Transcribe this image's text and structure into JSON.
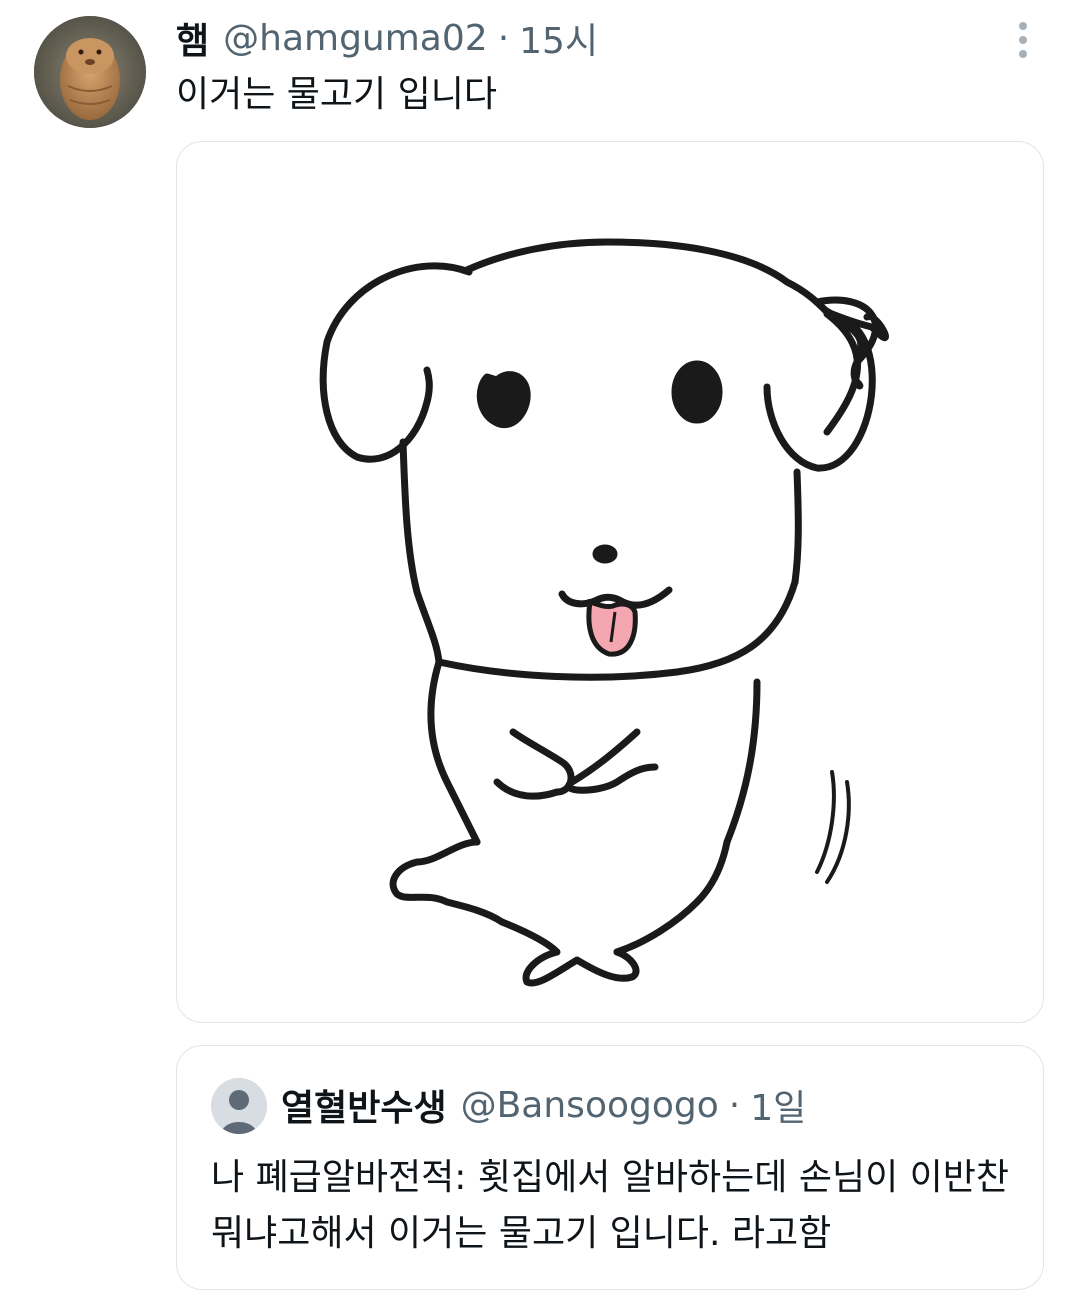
{
  "tweet": {
    "author": {
      "display_name": "햄",
      "handle": "@hamguma02",
      "avatar_icon": "hamster-avatar"
    },
    "separator": "·",
    "time": "15시",
    "text": "이거는 물고기 입니다",
    "more_icon": "more-vertical-icon",
    "media": {
      "description_icon": "dog-fish-drawing",
      "tongue_color": "#f4a7b0",
      "stroke_color": "#1a1a1a"
    }
  },
  "quoted_tweet": {
    "author": {
      "display_name": "열혈반수생",
      "handle": "@Bansoogogo",
      "avatar_icon": "default-user-icon"
    },
    "separator": "·",
    "time": "1일",
    "text": "나 폐급알바전적: 횟집에서 알바하는데 손님이 이반찬 뭐냐고해서 이거는 물고기 입니다. 라고함"
  },
  "colors": {
    "text_primary": "#0f1419",
    "text_secondary": "#536471",
    "border": "#e1e6ea",
    "background": "#ffffff"
  }
}
